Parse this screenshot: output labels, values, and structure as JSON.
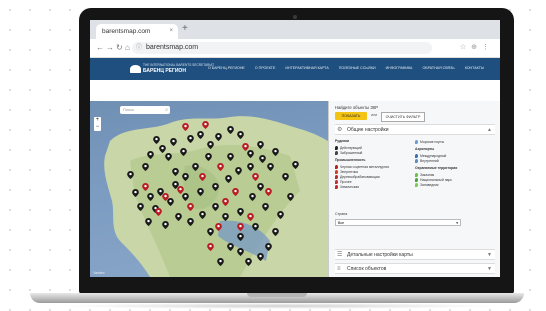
{
  "browser": {
    "tab_title": "barentsmap.com",
    "tab_close": "×",
    "new_tab": "+",
    "url": "barentsmap.com"
  },
  "site": {
    "logo_line1": "THE INTERNATIONAL BARENTS SECRETARIAT",
    "logo_line2": "БАРЕНЦ РЕГИОН",
    "menu": [
      "О БАРЕНЦ-РЕГИОНЕ",
      "О ПРОЕКТЕ",
      "ИНТЕРАКТИВНАЯ КАРТА",
      "ПОЛЕЗНЫЕ ССЫЛКИ",
      "ИНФОГРАФИКА",
      "ОБРАТНАЯ СВЯЗЬ",
      "КОНТАКТЫ"
    ]
  },
  "map": {
    "search_placeholder": "Поиск",
    "zoom_in": "+",
    "zoom_out": "−",
    "credit": "Yandex",
    "pins_dark": [
      [
        66,
        43
      ],
      [
        72,
        52
      ],
      [
        60,
        58
      ],
      [
        78,
        60
      ],
      [
        55,
        70
      ],
      [
        83,
        45
      ],
      [
        93,
        55
      ],
      [
        100,
        42
      ],
      [
        110,
        38
      ],
      [
        120,
        48
      ],
      [
        128,
        40
      ],
      [
        140,
        33
      ],
      [
        150,
        38
      ],
      [
        118,
        60
      ],
      [
        105,
        70
      ],
      [
        95,
        80
      ],
      [
        85,
        88
      ],
      [
        70,
        95
      ],
      [
        60,
        100
      ],
      [
        50,
        110
      ],
      [
        65,
        112
      ],
      [
        80,
        105
      ],
      [
        95,
        100
      ],
      [
        110,
        95
      ],
      [
        125,
        90
      ],
      [
        138,
        82
      ],
      [
        148,
        74
      ],
      [
        160,
        70
      ],
      [
        172,
        62
      ],
      [
        180,
        70
      ],
      [
        185,
        55
      ],
      [
        170,
        48
      ],
      [
        160,
        57
      ],
      [
        88,
        120
      ],
      [
        100,
        125
      ],
      [
        112,
        118
      ],
      [
        125,
        110
      ],
      [
        135,
        120
      ],
      [
        150,
        115
      ],
      [
        162,
        100
      ],
      [
        170,
        90
      ],
      [
        175,
        110
      ],
      [
        165,
        130
      ],
      [
        150,
        140
      ],
      [
        140,
        150
      ],
      [
        150,
        155
      ],
      [
        158,
        165
      ],
      [
        170,
        160
      ],
      [
        178,
        150
      ],
      [
        185,
        135
      ],
      [
        120,
        135
      ],
      [
        75,
        128
      ],
      [
        58,
        125
      ],
      [
        45,
        96
      ],
      [
        40,
        78
      ],
      [
        140,
        60
      ],
      [
        195,
        80
      ],
      [
        200,
        100
      ],
      [
        190,
        118
      ],
      [
        130,
        165
      ],
      [
        85,
        75
      ],
      [
        205,
        68
      ]
    ],
    "pins_red": [
      [
        95,
        30
      ],
      [
        115,
        28
      ],
      [
        155,
        50
      ],
      [
        130,
        70
      ],
      [
        112,
        80
      ],
      [
        90,
        93
      ],
      [
        75,
        100
      ],
      [
        68,
        115
      ],
      [
        55,
        90
      ],
      [
        100,
        110
      ],
      [
        128,
        130
      ],
      [
        145,
        95
      ],
      [
        165,
        80
      ],
      [
        178,
        95
      ],
      [
        150,
        130
      ],
      [
        120,
        150
      ],
      [
        135,
        105
      ],
      [
        160,
        120
      ]
    ]
  },
  "panel": {
    "title": "Найдите объекты ЗКР",
    "show_button": "ПОКАЗАТЬ",
    "or_label": "или",
    "clear_button": "ОЧИСТИТЬ ФИЛЬТР",
    "general_settings": "Общие настройки",
    "detail_settings": "Детальные настройки карты",
    "object_list": "Список объектов",
    "search_label": "Страна",
    "search_value": "Все",
    "legend": {
      "col1": [
        {
          "h": "Рудники",
          "items": [
            {
              "label": "Действующий",
              "color": "#222"
            },
            {
              "label": "Заброшенный",
              "color": "#444"
            }
          ]
        },
        {
          "h": "Промышленность",
          "items": [
            {
              "label": "Черная и цветная металлургия",
              "color": "#b52020"
            },
            {
              "label": "Энергетика",
              "color": "#d04020"
            },
            {
              "label": "Деревообрабатывающая",
              "color": "#b03030"
            },
            {
              "label": "Прочее",
              "color": "#c03030"
            },
            {
              "label": "Химическая",
              "color": "#c02828"
            }
          ]
        }
      ],
      "col2": [
        {
          "h": "",
          "items": [
            {
              "label": "Морские порты",
              "color": "#6a9cd2"
            }
          ]
        },
        {
          "h": "Аэропорты",
          "items": [
            {
              "label": "Международный",
              "color": "#3a6fb2"
            },
            {
              "label": "Внутренний",
              "color": "#5b8bc4"
            }
          ]
        },
        {
          "h": "Охраняемые территории",
          "items": [
            {
              "label": "Заказник",
              "color": "#6bbd4a"
            },
            {
              "label": "Национальный парк",
              "color": "#4aa23a"
            },
            {
              "label": "Заповедник",
              "color": "#7bc95a"
            }
          ]
        }
      ]
    }
  },
  "colors": {
    "header": "#1f4f7e",
    "accent": "#f3c316",
    "pin_dark": "#1a1a1a",
    "pin_red": "#b81d24"
  }
}
